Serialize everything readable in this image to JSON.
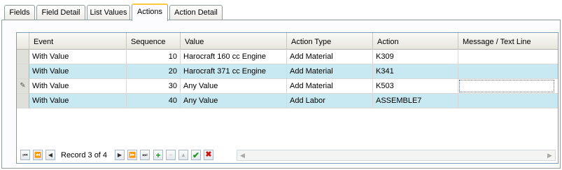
{
  "tabs": [
    {
      "label": "Fields",
      "active": false
    },
    {
      "label": "Field Detail",
      "active": false
    },
    {
      "label": "List Values",
      "active": false
    },
    {
      "label": "Actions",
      "active": true
    },
    {
      "label": "Action Detail",
      "active": false
    }
  ],
  "grid": {
    "columns": [
      "Event",
      "Sequence",
      "Value",
      "Action Type",
      "Action",
      "Message / Text Line"
    ],
    "rows": [
      {
        "event": "With Value",
        "sequence": "10",
        "value": "Harocraft 160 cc Engine",
        "action_type": "Add Material",
        "action": "K309",
        "message": ""
      },
      {
        "event": "With Value",
        "sequence": "20",
        "value": "Harocraft 371 cc Engine",
        "action_type": "Add Material",
        "action": "K341",
        "message": ""
      },
      {
        "event": "With Value",
        "sequence": "30",
        "value": "Any Value",
        "action_type": "Add Material",
        "action": "K503",
        "message": ""
      },
      {
        "event": "With Value",
        "sequence": "40",
        "value": "Any Value",
        "action_type": "Add Labor",
        "action": "ASSEMBLE7",
        "message": ""
      }
    ],
    "current_row_index": 2
  },
  "navigator": {
    "record_text": "Record 3 of 4",
    "buttons": {
      "first": "⏮",
      "prev_page": "⏪",
      "prev": "◀",
      "next": "▶",
      "next_page": "⏩",
      "last": "⏭",
      "append": "+",
      "delete": "−",
      "edit": "▲",
      "post": "✔",
      "cancel": "✖"
    },
    "scroll_left": "◀",
    "scroll_right": "▶"
  },
  "indicators": {
    "current_row": "✎"
  },
  "colors": {
    "alt_row": "#c9e9f2",
    "tab_highlight": "#ffc83c",
    "accept": "#1a9a1a",
    "cancel": "#cc1111"
  }
}
